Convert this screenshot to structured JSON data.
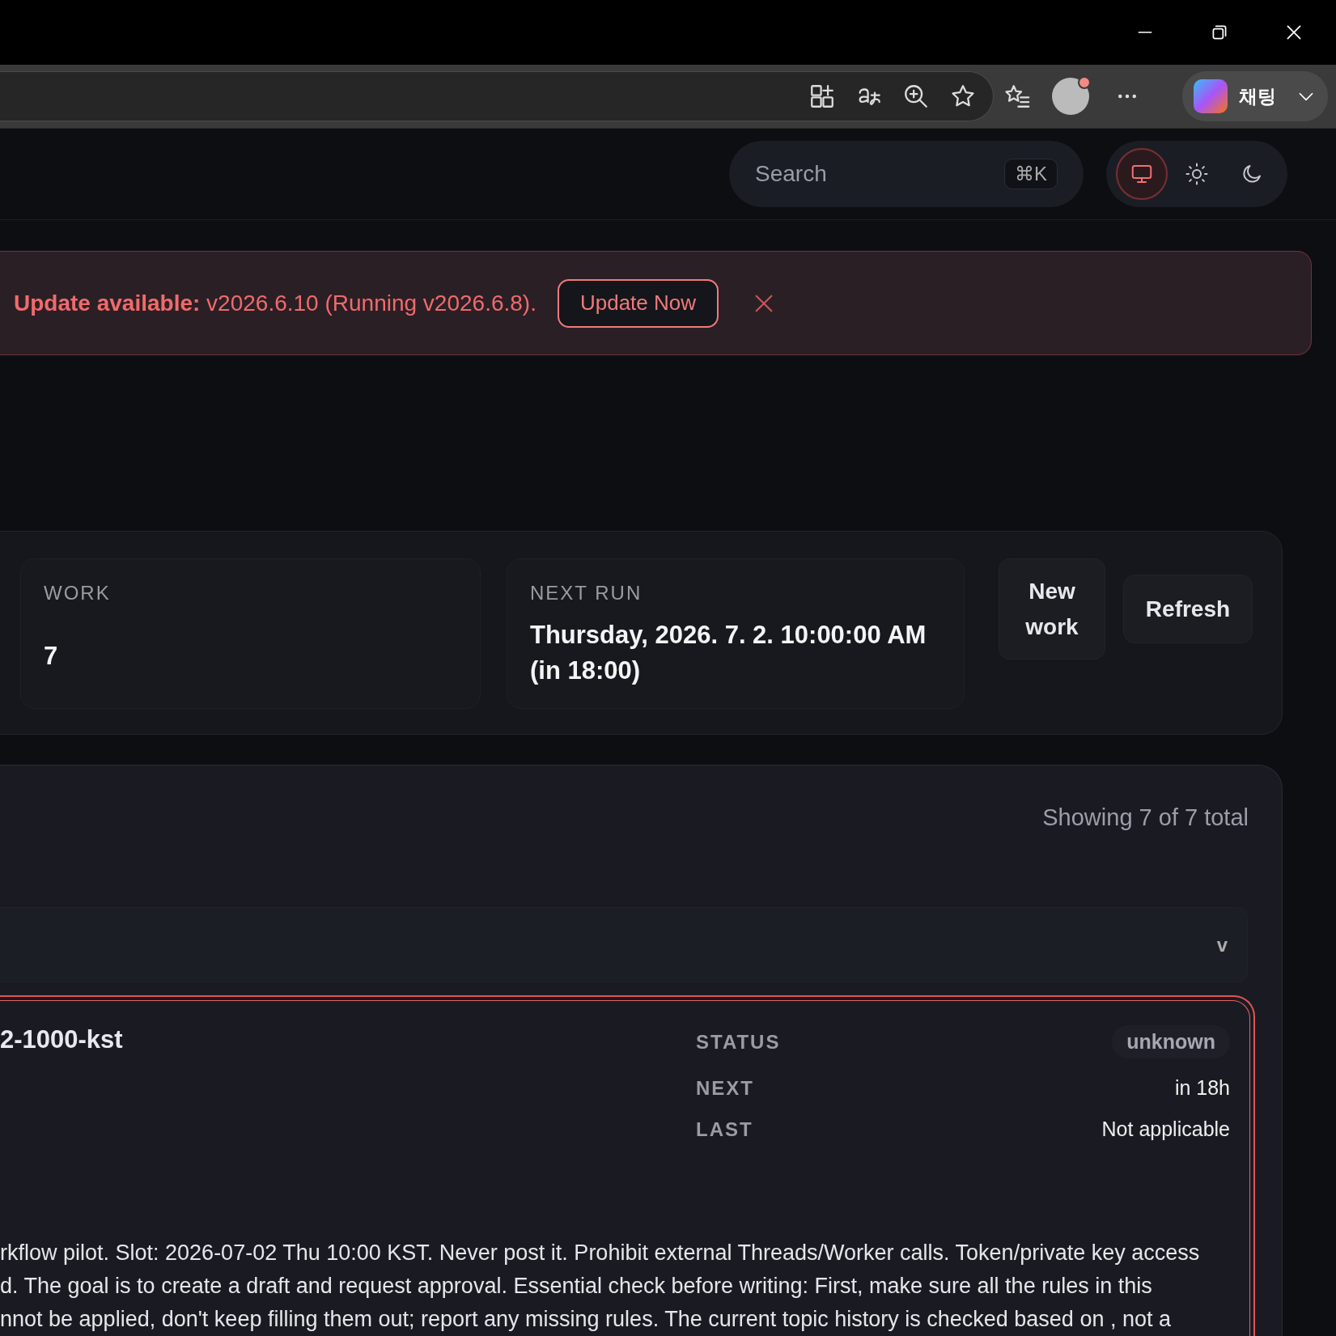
{
  "browser": {
    "copilot_label": "채팅"
  },
  "header": {
    "search": {
      "placeholder": "Search",
      "shortcut": "⌘K"
    },
    "theme_options": [
      {
        "kind": "system",
        "selected": true
      },
      {
        "kind": "light",
        "selected": false
      },
      {
        "kind": "dark",
        "selected": false
      }
    ]
  },
  "update_banner": {
    "label": "Update available:",
    "message": "v2026.6.10 (Running v2026.6.8).",
    "button": "Update Now"
  },
  "stats": [
    {
      "label": "WORK",
      "value": "7"
    },
    {
      "label": "NEXT RUN",
      "value": "Thursday, 2026. 7. 2. 10:00:00 AM (in 18:00)"
    }
  ],
  "actions": [
    "New work",
    "Refresh"
  ],
  "jobs": {
    "summary": "Showing 7 of 7 total",
    "filter": {
      "caret": "v"
    },
    "card": {
      "selected": true,
      "name": "2-1000-kst",
      "fields": [
        {
          "label": "STATUS",
          "value": "unknown",
          "kind": "badge"
        },
        {
          "label": "NEXT",
          "value": "in 18h",
          "kind": "text"
        },
        {
          "label": "LAST",
          "value": "Not applicable",
          "kind": "text"
        }
      ],
      "description": [
        "rkflow pilot. Slot: 2026-07-02 Thu 10:00 KST. Never post it. Prohibit external Threads/Worker calls. Token/private key access",
        "d. The goal is to create a draft and request approval. Essential check before writing: First, make sure all the rules in this",
        "nnot be applied, don't keep filling them out; report any missing rules. The current topic history is checked based on , not a"
      ]
    }
  }
}
